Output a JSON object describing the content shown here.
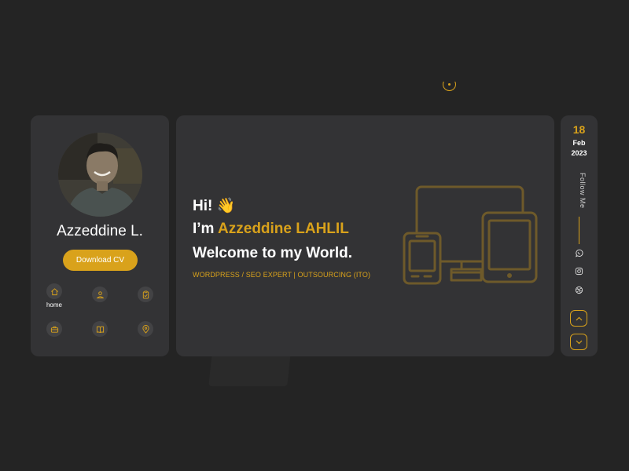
{
  "profile": {
    "name": "Azzeddine L.",
    "cv_button": "Download CV"
  },
  "nav": {
    "items": [
      {
        "icon": "home-icon",
        "label": "home"
      },
      {
        "icon": "user-icon",
        "label": ""
      },
      {
        "icon": "clipboard-icon",
        "label": ""
      },
      {
        "icon": "briefcase-icon",
        "label": ""
      },
      {
        "icon": "book-icon",
        "label": ""
      },
      {
        "icon": "location-pin-icon",
        "label": ""
      }
    ]
  },
  "hero": {
    "greeting": "Hi! 👋",
    "intro_prefix": "I’m ",
    "intro_name": "Azzeddine LAHLIL",
    "welcome": "Welcome to my World.",
    "tagline": "WORDPRESS / SEO EXPERT | OUTSOURCING (ITO)",
    "illustration": "devices-icon"
  },
  "sidebar": {
    "date_day": "18",
    "date_month": "Feb",
    "date_year": "2023",
    "follow_label": "Follow Me",
    "socials": [
      "whatsapp-icon",
      "instagram-icon",
      "dribbble-icon"
    ],
    "scroll_buttons": [
      "chevron-up-icon",
      "chevron-down-icon"
    ]
  },
  "colors": {
    "background": "#242424",
    "card": "#333335",
    "accent": "#d9a21b"
  }
}
